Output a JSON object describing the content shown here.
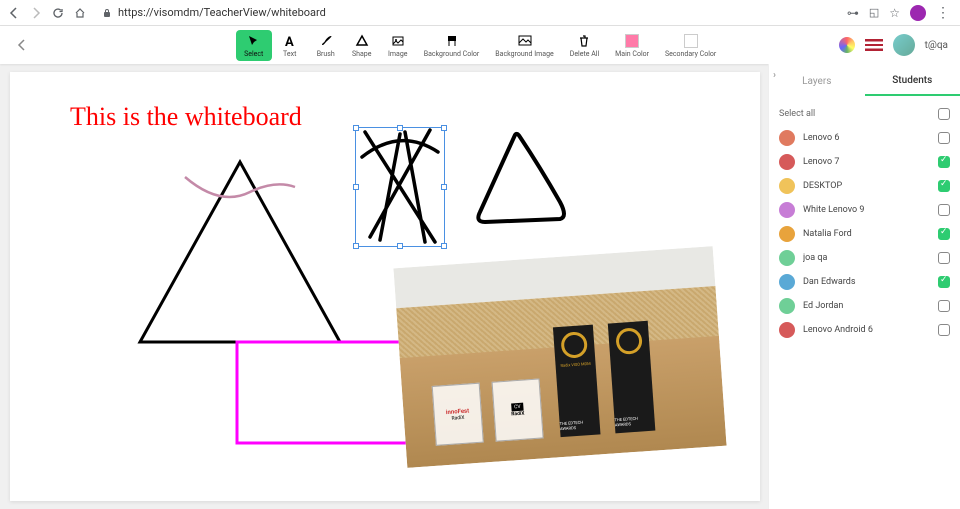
{
  "browser": {
    "url": "https://visomdm/TeacherView/whiteboard"
  },
  "header": {
    "user_label": "t@qa"
  },
  "toolbar": {
    "tools": [
      {
        "key": "select",
        "label": "Select",
        "active": true
      },
      {
        "key": "text",
        "label": "Text"
      },
      {
        "key": "brush",
        "label": "Brush"
      },
      {
        "key": "shape",
        "label": "Shape"
      },
      {
        "key": "image",
        "label": "Image"
      },
      {
        "key": "bgcolor",
        "label": "Background Color"
      },
      {
        "key": "bgimage",
        "label": "Background Image"
      },
      {
        "key": "deleteall",
        "label": "Delete All"
      },
      {
        "key": "maincolor",
        "label": "Main Color",
        "swatch": "#ff7aa8"
      },
      {
        "key": "seccolor",
        "label": "Secondary Color",
        "swatch": "#ffffff"
      }
    ]
  },
  "whiteboard": {
    "text": "This is the whiteboard",
    "image_logos": [
      "innoFest",
      "RadiX",
      "CV",
      "RadiX",
      "Radix VISO MDM",
      "THE EDTECH AWARDS",
      "THE EDTECH AWARDS"
    ]
  },
  "sidepanel": {
    "tabs": {
      "layers": "Layers",
      "students": "Students",
      "active": "students"
    },
    "select_all": "Select all",
    "students": [
      {
        "name": "Lenovo 6",
        "checked": false,
        "color": "#e07a5f"
      },
      {
        "name": "Lenovo 7",
        "checked": true,
        "color": "#d65a5a"
      },
      {
        "name": "DESKTOP",
        "checked": true,
        "color": "#f0c35a"
      },
      {
        "name": "White Lenovo 9",
        "checked": false,
        "color": "#c77dd6"
      },
      {
        "name": "Natalia Ford",
        "checked": true,
        "color": "#e8a33c"
      },
      {
        "name": "joa qa",
        "checked": false,
        "color": "#6fcf97"
      },
      {
        "name": "Dan Edwards",
        "checked": true,
        "color": "#5aa9d6"
      },
      {
        "name": "Ed Jordan",
        "checked": false,
        "color": "#6fcf97"
      },
      {
        "name": "Lenovo Android 6",
        "checked": false,
        "color": "#d65a5a"
      }
    ]
  }
}
